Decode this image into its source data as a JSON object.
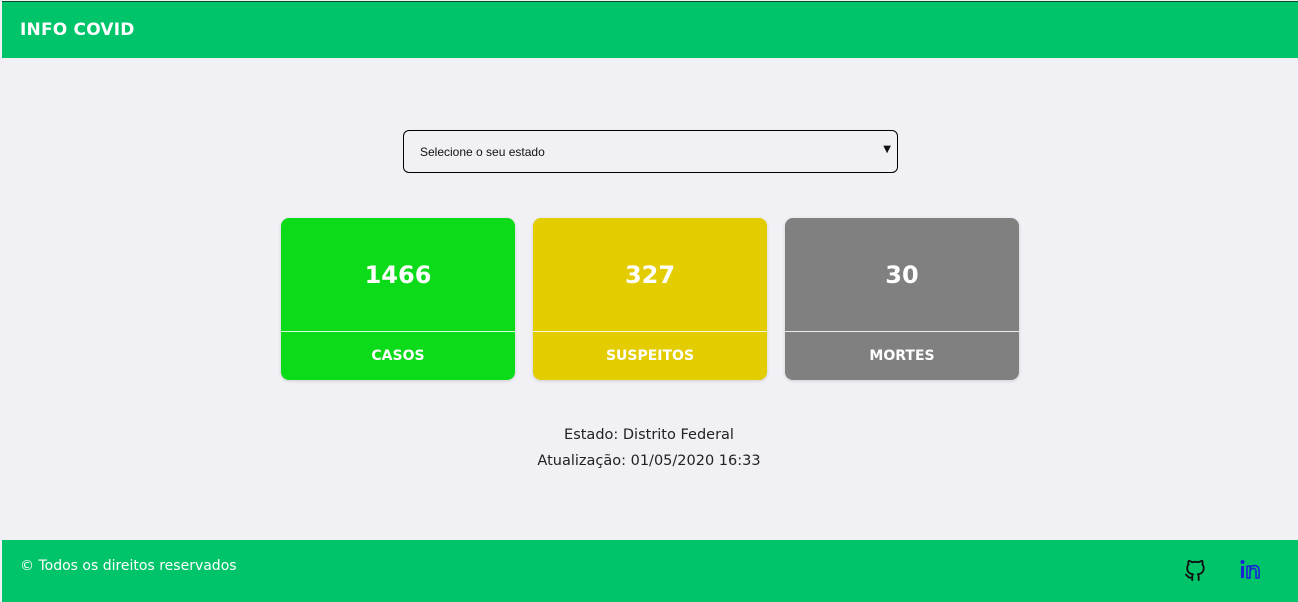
{
  "header": {
    "title": "INFO COVID"
  },
  "state_select": {
    "placeholder": "Selecione o seu estado",
    "arrow_icon": "triangle-down"
  },
  "cards": [
    {
      "value": "1466",
      "label": "CASOS",
      "color": "#0bdb18"
    },
    {
      "value": "327",
      "label": "SUSPEITOS",
      "color": "#e3cc00"
    },
    {
      "value": "30",
      "label": "MORTES",
      "color": "#808080"
    }
  ],
  "info": {
    "estado": "Estado: Distrito Federal",
    "atualizacao": "Atualização: 01/05/2020 16:33"
  },
  "footer": {
    "copyright": "© Todos os direitos reservados",
    "icons": [
      "github-icon",
      "linkedin-icon"
    ]
  },
  "colors": {
    "brand_green": "#00c46a",
    "background": "#f0f0f5",
    "linkedin_blue": "#1a22d6"
  }
}
